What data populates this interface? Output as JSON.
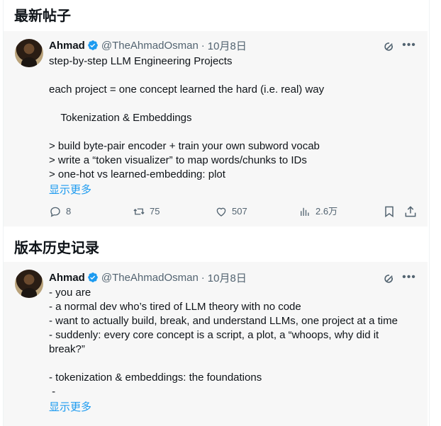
{
  "section1": {
    "title": "最新帖子"
  },
  "section2": {
    "title": "版本历史记录"
  },
  "post1": {
    "author": "Ahmad",
    "handle": "@TheAhmadOsman",
    "separator": "·",
    "date": "10月8日",
    "lines": [
      "step-by-step LLM Engineering Projects",
      "",
      "each project = one concept learned the hard (i.e. real) way",
      "",
      "    Tokenization & Embeddings",
      "",
      "> build byte-pair encoder + train your own subword vocab",
      "> write a “token visualizer” to map words/chunks to IDs",
      "> one-hot vs learned-embedding: plot"
    ],
    "show_more": "显示更多",
    "replies": "8",
    "reposts": "75",
    "likes": "507",
    "views": "2.6万"
  },
  "post2": {
    "author": "Ahmad",
    "handle": "@TheAhmadOsman",
    "separator": "·",
    "date": "10月8日",
    "lines": [
      "- you are",
      "- a normal dev who’s tired of LLM theory with no code",
      "- want to actually build, break, and understand LLMs, one project at a time",
      "- suddenly: every core concept is a script, a plot, a “whoops, why did it break?”",
      "",
      "- tokenization & embeddings: the foundations",
      " -"
    ],
    "show_more": "显示更多"
  },
  "colors": {
    "accent": "#1d9bf0",
    "muted": "#536471",
    "text": "#0f1419",
    "card": "#f7f7f7"
  },
  "icons": [
    "verified-badge-icon",
    "grok-icon",
    "more-icon",
    "reply-icon",
    "repost-icon",
    "like-icon",
    "views-icon",
    "bookmark-icon",
    "share-icon"
  ]
}
